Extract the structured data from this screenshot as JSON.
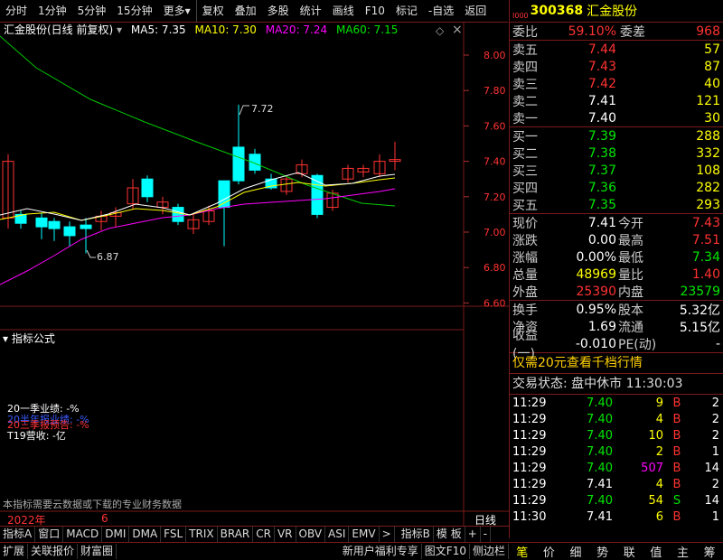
{
  "toolbar": {
    "buttons": [
      "分时",
      "1分钟",
      "5分钟",
      "15分钟",
      "更多",
      "复权",
      "叠加",
      "多股",
      "统计",
      "画线",
      "F10",
      "标记",
      "-自选",
      "返回"
    ]
  },
  "chart": {
    "stock_title": "汇金股份(日线 前复权)",
    "ma5": "MA5: 7.35",
    "ma10": "MA10: 7.30",
    "ma20": "MA20: 7.24",
    "ma60": "MA60: 7.15",
    "high_mark": "7.72",
    "low_mark": "6.87",
    "price_ticks": [
      "8.00",
      "7.80",
      "7.60",
      "7.40",
      "7.20",
      "7.00",
      "6.80",
      "6.60"
    ],
    "indicator_title": "指标公式",
    "ind_line1": "20一季业绩: -%",
    "ind_line2": "20半年报业绩: -%",
    "ind_line3": "20三季报预告: -%",
    "ind_line4": "T19营收: -亿",
    "ind_note": "本指标需要云数据或下载的专业财务数据",
    "year": "2022年",
    "month": "6",
    "period": "日线",
    "colors": {
      "up": "#ff3232",
      "down": "#00ffff",
      "ma5": "#ffffff",
      "ma10": "#ffff00",
      "ma20": "#ff00ff",
      "ma60": "#00c800"
    }
  },
  "quote": {
    "code": "300368",
    "name": "汇金股份",
    "tag": "I000",
    "webi_label": "委比",
    "webi": "59.10%",
    "weicha_label": "委差",
    "weicha": "968",
    "sells": [
      {
        "label": "卖五",
        "price": "7.44",
        "vol": "57"
      },
      {
        "label": "卖四",
        "price": "7.43",
        "vol": "87"
      },
      {
        "label": "卖三",
        "price": "7.42",
        "vol": "40"
      },
      {
        "label": "卖二",
        "price": "7.41",
        "vol": "121"
      },
      {
        "label": "卖一",
        "price": "7.40",
        "vol": "30"
      }
    ],
    "buys": [
      {
        "label": "买一",
        "price": "7.39",
        "vol": "288"
      },
      {
        "label": "买二",
        "price": "7.38",
        "vol": "332"
      },
      {
        "label": "买三",
        "price": "7.37",
        "vol": "108"
      },
      {
        "label": "买四",
        "price": "7.36",
        "vol": "282"
      },
      {
        "label": "买五",
        "price": "7.35",
        "vol": "293"
      }
    ],
    "stats": [
      {
        "l1": "现价",
        "v1": "7.41",
        "l2": "今开",
        "v2": "7.43"
      },
      {
        "l1": "涨跌",
        "v1": "0.00",
        "l2": "最高",
        "v2": "7.51"
      },
      {
        "l1": "涨幅",
        "v1": "0.00%",
        "l2": "最低",
        "v2": "7.34"
      },
      {
        "l1": "总量",
        "v1": "48969",
        "l2": "量比",
        "v2": "1.40"
      },
      {
        "l1": "外盘",
        "v1": "25390",
        "l2": "内盘",
        "v2": "23579"
      }
    ],
    "stats2": [
      {
        "l1": "换手",
        "v1": "0.95%",
        "l2": "股本",
        "v2": "5.32亿"
      },
      {
        "l1": "净资",
        "v1": "1.69",
        "l2": "流通",
        "v2": "5.15亿"
      },
      {
        "l1": "收益(一)",
        "v1": "-0.010",
        "l2": "PE(动)",
        "v2": "-"
      }
    ],
    "promo": "仅需20元查看千档行情",
    "trade_status": "交易状态: 盘中休市 11:30:03",
    "ticks": [
      {
        "t": "11:29",
        "p": "7.40",
        "v": "9",
        "s": "B",
        "n": "2"
      },
      {
        "t": "11:29",
        "p": "7.40",
        "v": "4",
        "s": "B",
        "n": "2"
      },
      {
        "t": "11:29",
        "p": "7.40",
        "v": "10",
        "s": "B",
        "n": "2"
      },
      {
        "t": "11:29",
        "p": "7.40",
        "v": "2",
        "s": "B",
        "n": "1"
      },
      {
        "t": "11:29",
        "p": "7.40",
        "v": "507",
        "s": "B",
        "n": "14"
      },
      {
        "t": "11:29",
        "p": "7.41",
        "v": "4",
        "s": "B",
        "n": "2"
      },
      {
        "t": "11:29",
        "p": "7.40",
        "v": "54",
        "s": "S",
        "n": "14"
      },
      {
        "t": "11:30",
        "p": "7.41",
        "v": "6",
        "s": "B",
        "n": "1"
      }
    ]
  },
  "bottom_tabs": [
    "指标A",
    "窗口",
    "MACD",
    "DMI",
    "DMA",
    "FSL",
    "TRIX",
    "BRAR",
    "CR",
    "VR",
    "OBV",
    "ASI",
    "EMV",
    ">",
    "指标B",
    "模 板",
    "+",
    "-"
  ],
  "status_bar": {
    "left": [
      "扩展",
      "关联报价",
      "财富圈"
    ],
    "right": [
      "新用户福利专享",
      "图文F10",
      "侧边栏"
    ],
    "nav": [
      "笔",
      "价",
      "细",
      "势",
      "联",
      "值",
      "主",
      "筹"
    ]
  }
}
